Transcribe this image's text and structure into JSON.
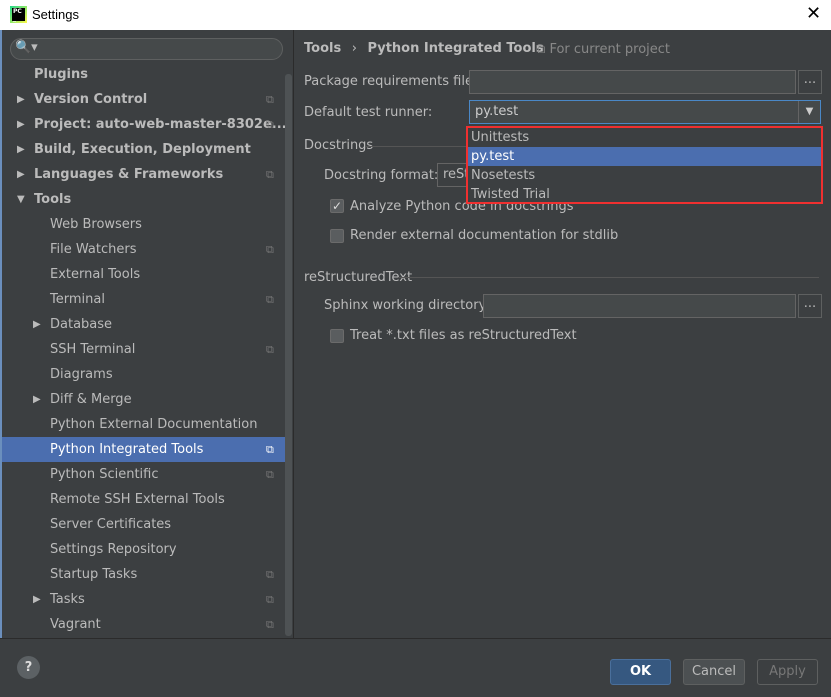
{
  "window": {
    "title": "Settings",
    "close": "✕"
  },
  "search": {
    "icon": "🔍▾",
    "placeholder": ""
  },
  "sidebar": {
    "items": [
      {
        "label": "Plugins",
        "level": 0,
        "arrow": "",
        "copy": false
      },
      {
        "label": "Version Control",
        "level": 0,
        "arrow": "▶",
        "copy": true
      },
      {
        "label": "Project: auto-web-master-8302e...",
        "level": 0,
        "arrow": "▶",
        "copy": true
      },
      {
        "label": "Build, Execution, Deployment",
        "level": 0,
        "arrow": "▶",
        "copy": false
      },
      {
        "label": "Languages & Frameworks",
        "level": 0,
        "arrow": "▶",
        "copy": true
      },
      {
        "label": "Tools",
        "level": 0,
        "arrow": "▼",
        "copy": false
      },
      {
        "label": "Web Browsers",
        "level": 1,
        "arrow": "",
        "copy": false
      },
      {
        "label": "File Watchers",
        "level": 1,
        "arrow": "",
        "copy": true
      },
      {
        "label": "External Tools",
        "level": 1,
        "arrow": "",
        "copy": false
      },
      {
        "label": "Terminal",
        "level": 1,
        "arrow": "",
        "copy": true
      },
      {
        "label": "Database",
        "level": 1,
        "arrow": "▶",
        "copy": false
      },
      {
        "label": "SSH Terminal",
        "level": 1,
        "arrow": "",
        "copy": true
      },
      {
        "label": "Diagrams",
        "level": 1,
        "arrow": "",
        "copy": false
      },
      {
        "label": "Diff & Merge",
        "level": 1,
        "arrow": "▶",
        "copy": false
      },
      {
        "label": "Python External Documentation",
        "level": 1,
        "arrow": "",
        "copy": false
      },
      {
        "label": "Python Integrated Tools",
        "level": 1,
        "arrow": "",
        "copy": true,
        "selected": true
      },
      {
        "label": "Python Scientific",
        "level": 1,
        "arrow": "",
        "copy": true
      },
      {
        "label": "Remote SSH External Tools",
        "level": 1,
        "arrow": "",
        "copy": false
      },
      {
        "label": "Server Certificates",
        "level": 1,
        "arrow": "",
        "copy": false
      },
      {
        "label": "Settings Repository",
        "level": 1,
        "arrow": "",
        "copy": false
      },
      {
        "label": "Startup Tasks",
        "level": 1,
        "arrow": "",
        "copy": true
      },
      {
        "label": "Tasks",
        "level": 1,
        "arrow": "▶",
        "copy": true
      },
      {
        "label": "Vagrant",
        "level": 1,
        "arrow": "",
        "copy": true
      }
    ]
  },
  "breadcrumb": {
    "parent": "Tools",
    "sep": "›",
    "current": "Python Integrated Tools",
    "scope_icon": "⧉",
    "scope": "For current project"
  },
  "form": {
    "package_label": "Package requirements file:",
    "package_value": "",
    "browse": "...",
    "runner_label": "Default test runner:",
    "runner_value": "py.test",
    "runner_arrow": "▼",
    "docstrings_group": "Docstrings",
    "docstring_format_label": "Docstring format:",
    "docstring_format_value": "reSt",
    "analyze_label": "Analyze Python code in docstrings",
    "analyze_checked": true,
    "render_label": "Render external documentation for stdlib",
    "render_checked": false,
    "rst_group": "reStructuredText",
    "sphinx_label": "Sphinx working directory:",
    "sphinx_value": "",
    "treat_label": "Treat *.txt files as reStructuredText",
    "treat_checked": false
  },
  "dropdown": {
    "options": [
      "Unittests",
      "py.test",
      "Nosetests",
      "Twisted Trial"
    ],
    "selected": "py.test",
    "highlight_color": "#f03030"
  },
  "footer": {
    "help": "?",
    "ok": "OK",
    "cancel": "Cancel",
    "apply": "Apply"
  }
}
